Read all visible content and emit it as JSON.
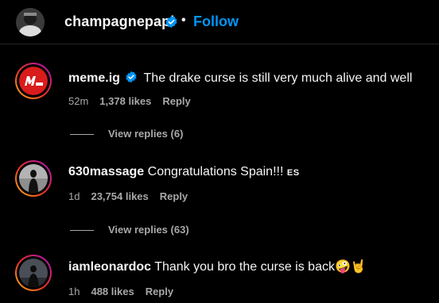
{
  "header": {
    "username": "champagnepapi",
    "separator": "•",
    "follow_label": "Follow"
  },
  "comments": [
    {
      "username": "meme.ig",
      "verified": true,
      "text": "The drake curse is still very much alive and well",
      "time": "52m",
      "likes": "1,378 likes",
      "reply_label": "Reply",
      "view_replies": "View replies (6)"
    },
    {
      "username": "630massage",
      "verified": false,
      "text": "Congratulations Spain!!!",
      "flag": "ES",
      "time": "1d",
      "likes": "23,754 likes",
      "reply_label": "Reply",
      "view_replies": "View replies (63)"
    },
    {
      "username": "iamleonardoc",
      "verified": false,
      "text": "Thank you bro the curse is back",
      "emojis": "🤪🤘",
      "time": "1h",
      "likes": "488 likes",
      "reply_label": "Reply"
    }
  ],
  "colors": {
    "background": "#000000",
    "text": "#f5f5f5",
    "secondary": "#a8a8a8",
    "link": "#0095f6",
    "verified": "#0095f6"
  }
}
